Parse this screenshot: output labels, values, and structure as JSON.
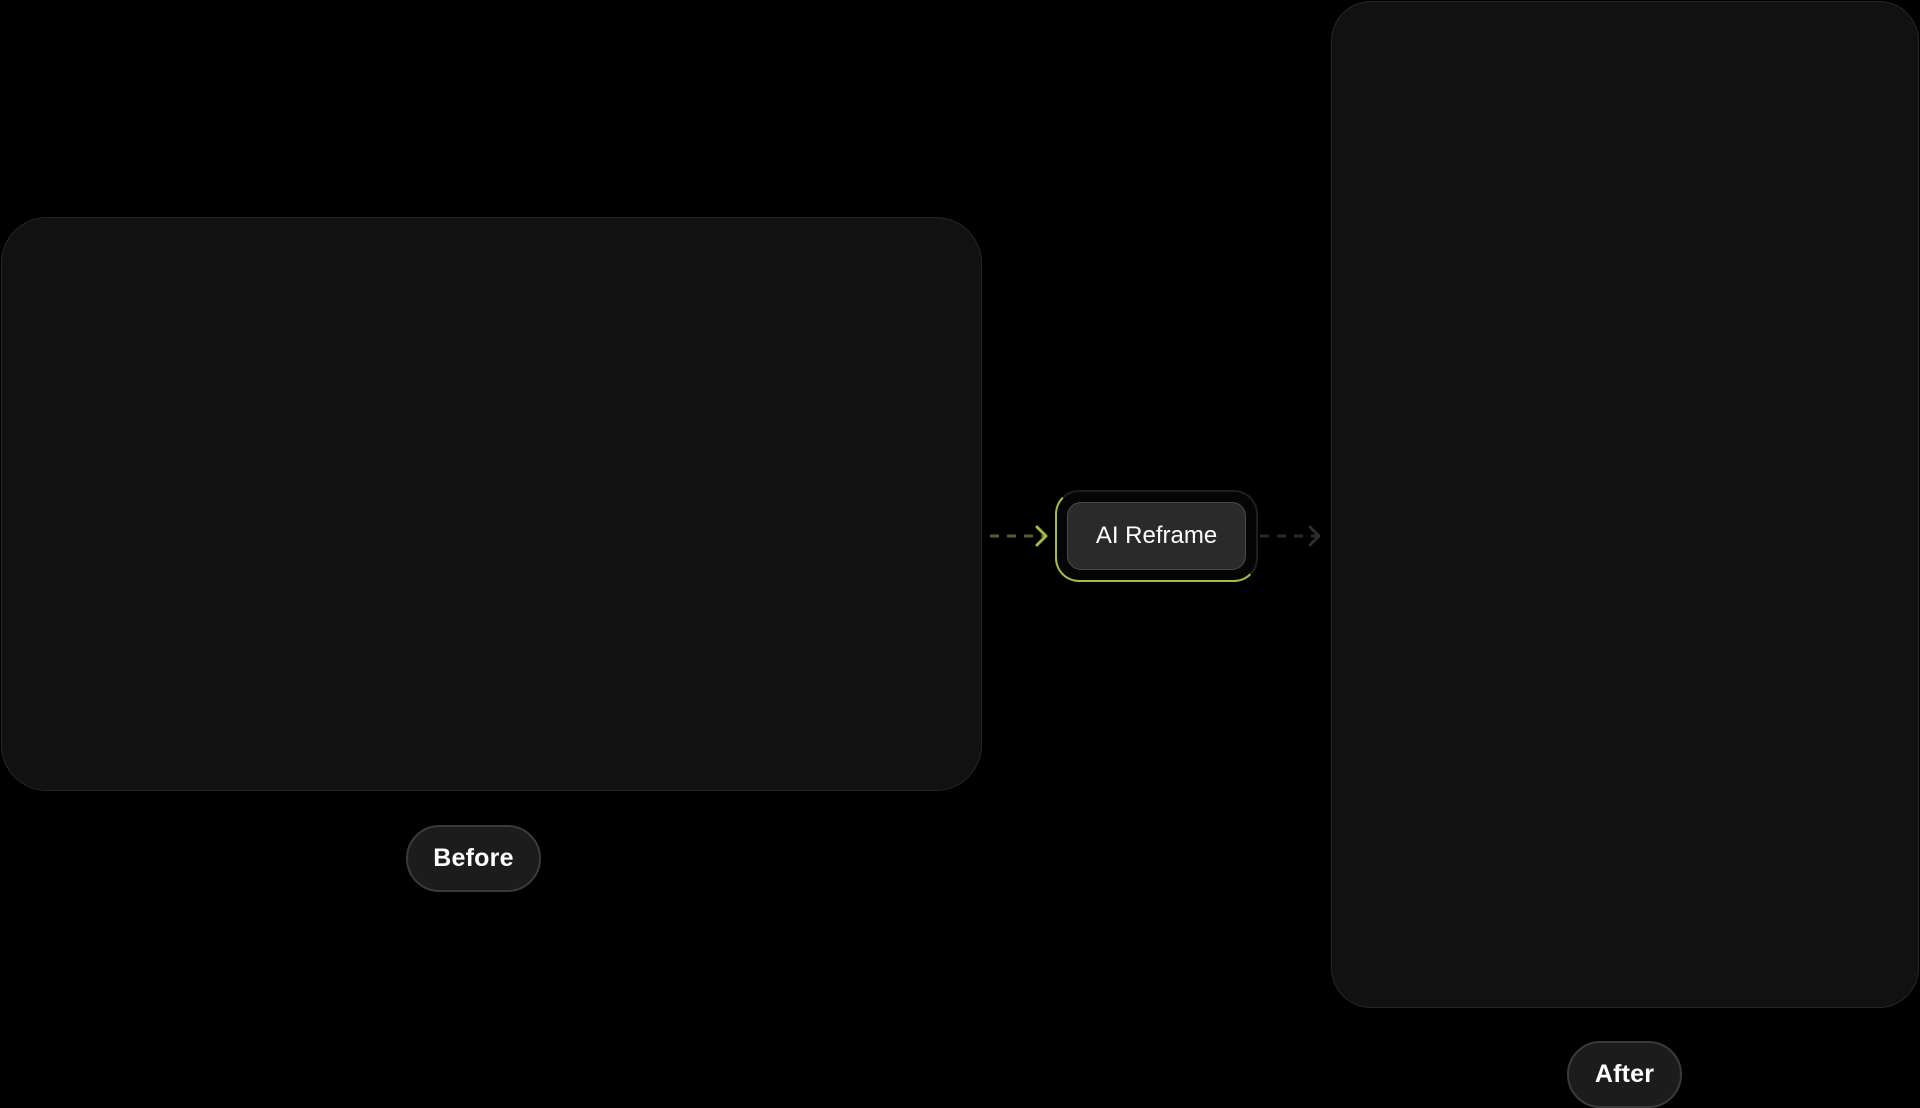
{
  "labels": {
    "before": "Before",
    "after": "After"
  },
  "action": {
    "label": "AI Reframe"
  },
  "colors": {
    "background": "#000000",
    "frame_fill": "#111111",
    "accent": "#a9b845",
    "pill_fill": "#1c1c1c"
  },
  "icons": {
    "incoming": "arrow-right-icon",
    "outgoing": "arrow-right-icon"
  }
}
